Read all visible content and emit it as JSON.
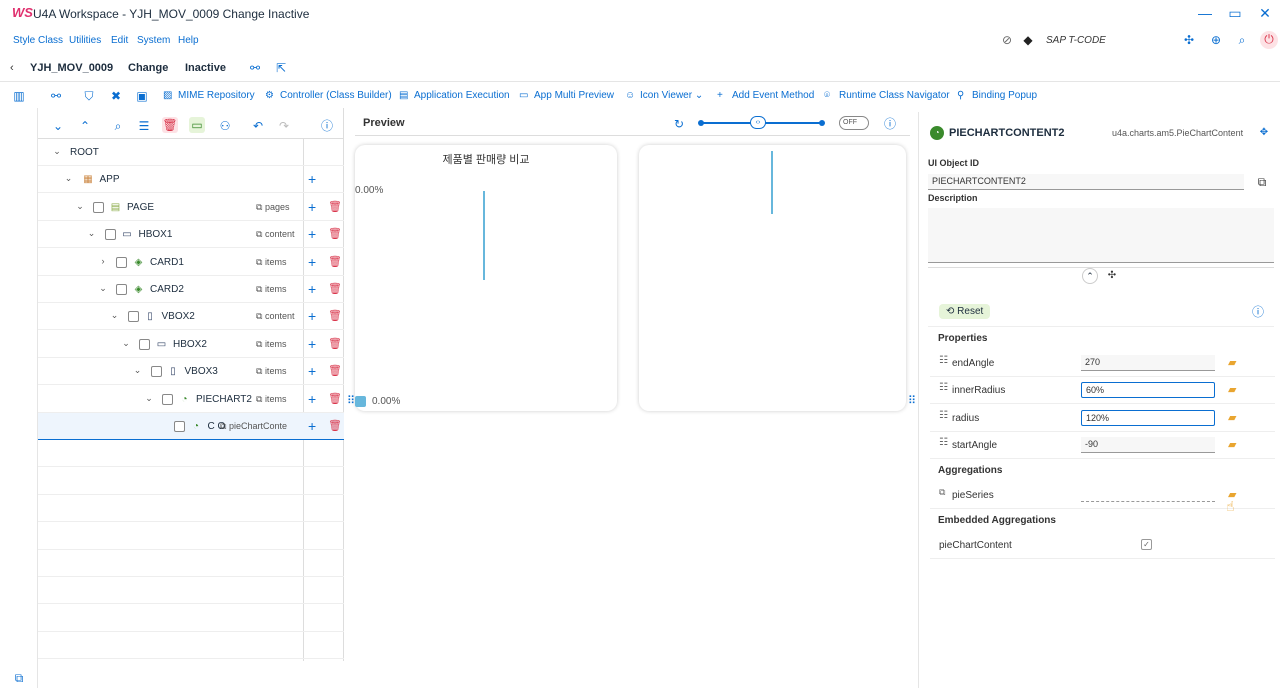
{
  "window": {
    "logo": "WS",
    "title": "U4A Workspace - YJH_MOV_0009 Change Inactive"
  },
  "menu": [
    "Style Class",
    "Utilities",
    "Edit",
    "System",
    "Help"
  ],
  "tcode_placeholder": "SAP T-CODE",
  "header": {
    "back": "‹",
    "app_id": "YJH_MOV_0009",
    "mode": "Change",
    "status": "Inactive"
  },
  "toolbar": [
    {
      "label": "MIME Repository",
      "icon": "image-icon"
    },
    {
      "label": "Controller (Class Builder)",
      "icon": "settings-icon"
    },
    {
      "label": "Application Execution",
      "icon": "run-icon"
    },
    {
      "label": "App Multi Preview",
      "icon": "monitor-icon"
    },
    {
      "label": "Icon Viewer",
      "icon": "smiley-icon"
    },
    {
      "label": "Add Event Method",
      "icon": "plus-icon"
    },
    {
      "label": "Runtime Class Navigator",
      "icon": "pin-icon"
    },
    {
      "label": "Binding Popup",
      "icon": "link-icon"
    }
  ],
  "tree": [
    {
      "name": "ROOT",
      "agg": "",
      "level": 0,
      "expander": "⌄",
      "checkbox": false,
      "icon": "",
      "actions": false
    },
    {
      "name": "APP",
      "agg": "",
      "level": 1,
      "expander": "⌄",
      "checkbox": false,
      "icon": "app-icon",
      "actions": "plus"
    },
    {
      "name": "PAGE",
      "agg": "pages",
      "level": 2,
      "expander": "⌄",
      "checkbox": true,
      "icon": "page-icon",
      "actions": "both"
    },
    {
      "name": "HBOX1",
      "agg": "content",
      "level": 3,
      "expander": "⌄",
      "checkbox": true,
      "icon": "hbox-icon",
      "actions": "both"
    },
    {
      "name": "CARD1",
      "agg": "items",
      "level": 4,
      "expander": "›",
      "checkbox": true,
      "icon": "card-icon",
      "actions": "both"
    },
    {
      "name": "CARD2",
      "agg": "items",
      "level": 4,
      "expander": "⌄",
      "checkbox": true,
      "icon": "card-icon",
      "actions": "both"
    },
    {
      "name": "VBOX2",
      "agg": "content",
      "level": 5,
      "expander": "⌄",
      "checkbox": true,
      "icon": "vbox-icon",
      "actions": "both"
    },
    {
      "name": "HBOX2",
      "agg": "items",
      "level": 6,
      "expander": "⌄",
      "checkbox": true,
      "icon": "hbox-icon",
      "actions": "both"
    },
    {
      "name": "VBOX3",
      "agg": "items",
      "level": 7,
      "expander": "⌄",
      "checkbox": true,
      "icon": "vbox-icon",
      "actions": "both"
    },
    {
      "name": "PIECHART2",
      "agg": "items",
      "level": 8,
      "expander": "⌄",
      "checkbox": true,
      "icon": "piechart-icon",
      "actions": "both"
    },
    {
      "name": "C O",
      "agg": "pieChartConte",
      "level": 9,
      "expander": "",
      "checkbox": true,
      "icon": "piechart-icon",
      "actions": "both"
    }
  ],
  "preview": {
    "label": "Preview",
    "toggle": "OFF",
    "card1_title": "제품별 판매량 비교",
    "card1_axis": "0.00%",
    "card1_legend": "0.00%"
  },
  "props": {
    "object_name": "PIECHARTCONTENT2",
    "object_class": "u4a.charts.am5.PieChartContent",
    "ui_object_id_label": "UI Object ID",
    "ui_object_id": "PIECHARTCONTENT2",
    "description_label": "Description",
    "reset": "Reset",
    "properties_label": "Properties",
    "properties": [
      {
        "name": "endAngle",
        "value": "270",
        "active": false
      },
      {
        "name": "innerRadius",
        "value": "60%",
        "active": true
      },
      {
        "name": "radius",
        "value": "120%",
        "active": true
      },
      {
        "name": "startAngle",
        "value": "-90",
        "active": false
      }
    ],
    "aggregations_label": "Aggregations",
    "aggregation": "pieSeries",
    "embedded_label": "Embedded Aggregations",
    "embedded": "pieChartContent"
  }
}
